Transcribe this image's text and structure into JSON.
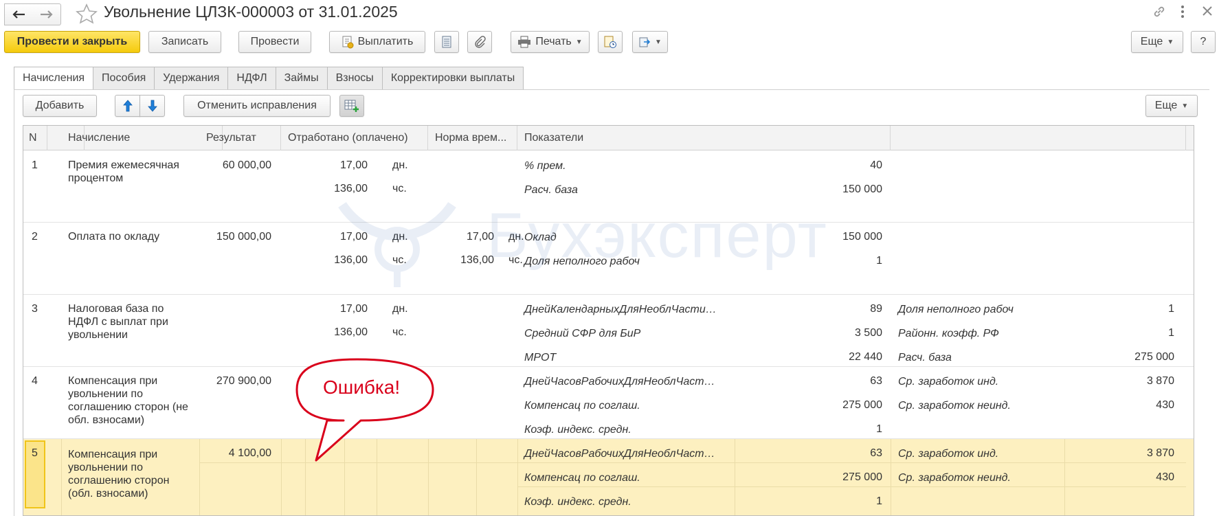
{
  "window": {
    "title": "Увольнение ЦЛЗК-000003 от 31.01.2025"
  },
  "toolbar": {
    "post_and_close": "Провести и закрыть",
    "save": "Записать",
    "post": "Провести",
    "pay": "Выплатить",
    "print": "Печать",
    "more": "Еще",
    "help": "?"
  },
  "tabs": [
    {
      "label": "Начисления",
      "active": true
    },
    {
      "label": "Пособия"
    },
    {
      "label": "Удержания"
    },
    {
      "label": "НДФЛ"
    },
    {
      "label": "Займы"
    },
    {
      "label": "Взносы"
    },
    {
      "label": "Корректировки выплаты"
    }
  ],
  "subtoolbar": {
    "add": "Добавить",
    "cancel_corrections": "Отменить исправления",
    "more": "Еще"
  },
  "table": {
    "headers": [
      "N",
      "Начисление",
      "Результат",
      "Отработано (оплачено)",
      "Норма врем...",
      "Показатели"
    ],
    "rows": [
      {
        "n": "1",
        "name": "Премия ежемесячная процентом",
        "result": "60 000,00",
        "worked": [
          [
            "17,00",
            "дн."
          ],
          [
            "136,00",
            "чс."
          ]
        ],
        "norm": [],
        "ind1": [
          [
            "% прем.",
            "40"
          ],
          [
            "Расч. база",
            "150 000"
          ]
        ],
        "ind2": []
      },
      {
        "n": "2",
        "name": "Оплата по окладу",
        "result": "150 000,00",
        "worked": [
          [
            "17,00",
            "дн."
          ],
          [
            "136,00",
            "чс."
          ]
        ],
        "norm": [
          [
            "17,00",
            "дн."
          ],
          [
            "136,00",
            "чс."
          ]
        ],
        "ind1": [
          [
            "Оклад",
            "150 000"
          ],
          [
            "Доля неполного рабоч",
            "1"
          ]
        ],
        "ind2": []
      },
      {
        "n": "3",
        "name": "Налоговая база по НДФЛ с выплат при увольнении",
        "result": "",
        "worked": [
          [
            "17,00",
            "дн."
          ],
          [
            "136,00",
            "чс."
          ]
        ],
        "norm": [],
        "ind1": [
          [
            "ДнейКалендарныхДляНеоблЧасти…",
            "89"
          ],
          [
            "Средний СФР для БиР",
            "3 500"
          ],
          [
            "МРОТ",
            "22 440"
          ]
        ],
        "ind2": [
          [
            "Доля неполного рабоч",
            "1"
          ],
          [
            "Районн. коэфф. РФ",
            "1"
          ],
          [
            "Расч. база",
            "275 000"
          ]
        ]
      },
      {
        "n": "4",
        "name": "Компенсация при увольнении по соглашению сторон (не обл. взносами)",
        "result": "270 900,00",
        "worked": [],
        "norm": [],
        "ind1": [
          [
            "ДнейЧасовРабочихДляНеоблЧаст…",
            "63"
          ],
          [
            "Компенсац по соглаш.",
            "275 000"
          ],
          [
            "Коэф. индекс. средн.",
            "1"
          ]
        ],
        "ind2": [
          [
            "Ср. заработок инд.",
            "3 870"
          ],
          [
            "Ср. заработок неинд.",
            "430"
          ]
        ]
      },
      {
        "n": "5",
        "name": "Компенсация при увольнении по соглашению сторон (обл. взносами)",
        "result": "4 100,00",
        "worked": [],
        "norm": [],
        "ind1": [
          [
            "ДнейЧасовРабочихДляНеоблЧаст…",
            "63"
          ],
          [
            "Компенсац по соглаш.",
            "275 000"
          ],
          [
            "Коэф. индекс. средн.",
            "1"
          ]
        ],
        "ind2": [
          [
            "Ср. заработок инд.",
            "3 870"
          ],
          [
            "Ср. заработок неинд.",
            "430"
          ]
        ],
        "selected": true
      }
    ]
  },
  "callout": {
    "text": "Ошибка!",
    "color": "#d9001b"
  },
  "watermark": {
    "text": "Бухэксперт"
  },
  "colors": {
    "primary_button": "#f5cb0d",
    "selected_row": "#fdf0c0",
    "arrow_blue": "#1f7fd8"
  }
}
